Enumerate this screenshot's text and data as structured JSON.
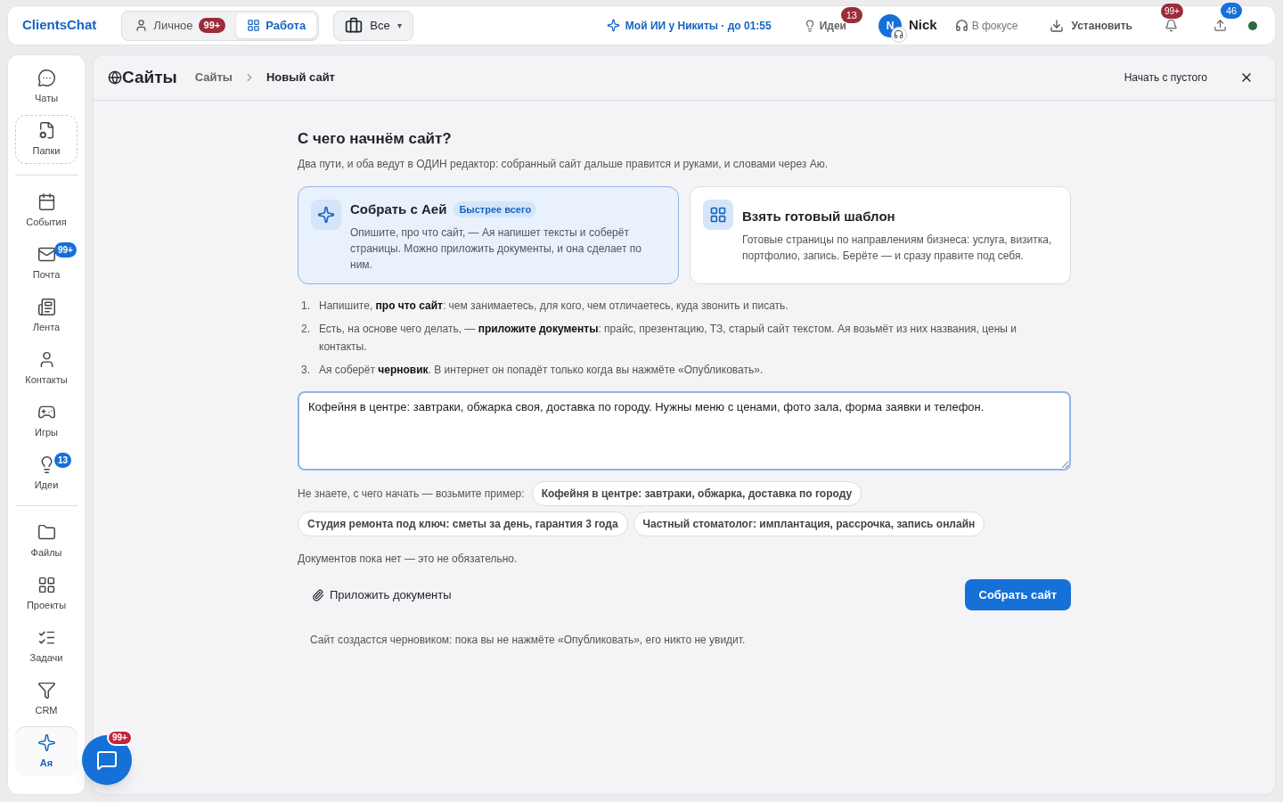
{
  "topbar": {
    "logo": "ClientsChat",
    "spaces": [
      {
        "label": "Личное",
        "badge": "99+",
        "selected": false
      },
      {
        "label": "Работа",
        "selected": true
      }
    ],
    "filter": "Все",
    "filter_caret": "▾",
    "ai": "Мой ИИ у Никиты · до 01:55",
    "ideas": {
      "label": "Идеи",
      "badge": "13"
    },
    "user": {
      "initial": "N",
      "name": "Nick"
    },
    "focus": "В фокусе",
    "install": "Установить",
    "notifications_badge": "99+",
    "uploads_badge": "46"
  },
  "sidebar": {
    "items": [
      {
        "label": "Чаты",
        "kind": "chat",
        "selected": false
      },
      {
        "label": "Папки",
        "kind": "folders",
        "selected": false
      },
      {
        "kind": "divider"
      },
      {
        "label": "События",
        "kind": "calendar",
        "selected": false
      },
      {
        "label": "Почта",
        "kind": "mail",
        "badge": "99+",
        "selected": false
      },
      {
        "label": "Лента",
        "kind": "feed",
        "selected": false
      },
      {
        "label": "Контакты",
        "kind": "contacts",
        "selected": false
      },
      {
        "label": "Игры",
        "kind": "games",
        "selected": false
      },
      {
        "label": "Идеи",
        "kind": "ideas",
        "badge": "13",
        "selected": false
      },
      {
        "kind": "divider"
      },
      {
        "label": "Файлы",
        "kind": "files",
        "selected": false
      },
      {
        "label": "Проекты",
        "kind": "projects",
        "selected": false
      },
      {
        "label": "Задачи",
        "kind": "tasks",
        "selected": false
      },
      {
        "label": "CRM",
        "kind": "crm",
        "selected": false
      },
      {
        "label": "Ая",
        "kind": "ai",
        "selected": true
      }
    ]
  },
  "header": {
    "title": "Сайты",
    "breadcrumbs": [
      "Сайты",
      "Новый сайт"
    ],
    "start_blank": "Начать с пустого"
  },
  "content": {
    "heading": "С чего начнём сайт?",
    "subheading": "Два пути, и оба ведут в ОДИН редактор: собранный сайт дальше правится и руками, и словами через Аю.",
    "options": [
      {
        "kind": "ai",
        "title": "Собрать с Аей",
        "tag": "Быстрее всего",
        "text": "Опишите, про что сайт, — Ая напишет тексты и соберёт страницы. Можно приложить документы, и она сделает по ним.",
        "selected": true
      },
      {
        "kind": "template",
        "title": "Взять готовый шаблон",
        "text": "Готовые страницы по направлениям бизнеса: услуга, визитка, портфолио, запись. Берёте — и сразу правите под себя.",
        "selected": false
      }
    ],
    "steps": [
      {
        "number": "1.",
        "text": "Напишите, **про что сайт**: чем занимаетесь, для кого, чем отличаетесь, куда звонить и писать."
      },
      {
        "number": "2.",
        "text": "Есть, на основе чего делать, — **приложите документы**: прайс, презентацию, ТЗ, старый сайт текстом. Ая возьмёт из них названия, цены и контакты."
      },
      {
        "number": "3.",
        "text": "Ая соберёт **черновик**. В интернет он попадёт только когда вы нажмёте «Опубликовать»."
      }
    ],
    "description": "Кофейня в центре: завтраки, обжарка своя, доставка по городу. Нужны меню с ценами, фото зала, форма заявки и телефон.",
    "examples_label": "Не знаете, с чего начать — возьмите пример:",
    "examples": [
      "Кофейня в центре: завтраки, обжарка, доставка по городу",
      "Студия ремонта под ключ: сметы за день, гарантия 3 года",
      "Частный стоматолог: имплантация, рассрочка, запись онлайн"
    ],
    "docs_note": "Документов пока нет — это не обязательно.",
    "attach": "Приложить документы",
    "submit": "Собрать сайт",
    "footnote": "Сайт создастся черновиком: пока вы не нажмёте «Опубликовать», его никто не увидит."
  },
  "chat_fab": {
    "badge": "99+"
  }
}
